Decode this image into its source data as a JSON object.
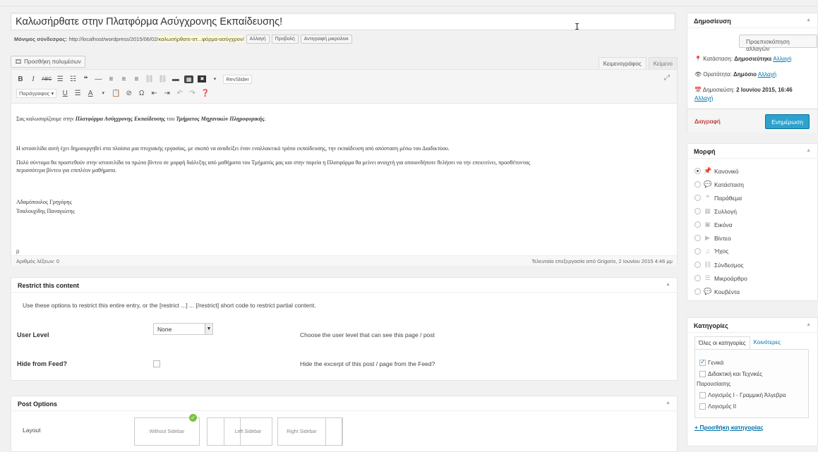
{
  "post": {
    "title": "Καλωσήρθατε στην Πλατφόρμα Ασύγχρονης Εκπαίδευσης!",
    "permalink_label": "Μόνιμος σύνδεσμος:",
    "permalink_url": "http://localhost/wordpress/2015/06/02/",
    "permalink_slug": "καλωσήρθατε-στ...φόρμα-ασύγχρον/",
    "permalink_buttons": [
      "Αλλαγή",
      "Προβολή",
      "Αντιγραφή μικρολινκ"
    ]
  },
  "editor": {
    "add_media": "Προσθήκη πολυμέσων",
    "tab_visual": "Κειμενογράφος",
    "tab_text": "Κείμενο",
    "toolbar_row1": [
      "B",
      "I",
      "ABC",
      "≡",
      "≡",
      "❝",
      "—",
      "≡",
      "≡",
      "≡",
      "🔗",
      "⛓",
      "▬",
      "▦"
    ],
    "revslider": "RevSlider",
    "format_select": "Παράγραφος ▾",
    "toolbar_row2": [
      "U",
      "≡",
      "A ▾",
      "📋",
      "⊘",
      "Ω",
      "⇥",
      "⇤",
      "↶",
      "↷",
      "❓"
    ],
    "content": {
      "p1_pre": "Σας καλωσορίζουμε στην ",
      "p1_bold1": "Πλατφόρμα Ασύγχρονης Εκπαίδευσης",
      "p1_mid": " του ",
      "p1_bold2": "Τμήματος Μηχανικών Πληροφορικής",
      "p1_end": ".",
      "p2": "Η ιστοσελίδα αυτή έχει δημιουργηθεί στα πλαίσια μια πτυχιακής εργασίας, με σκοπό να αναδείξει έναν εναλλακτικό τρόπο εκπαίδευσης, την εκπαίδευση από απόσταση μέσω του Διαδικτύου.",
      "p3": "Πολύ σύντομα θα προστεθούν στην ιστοσελίδα τα πρώτα βίντεο σε μορφή διάλεξης από μαθήματα του Τμήματός μας και στην πορεία η Πλατφόρμα θα μείνει ανοιχτή για οποιονδήποτε θελήσει να την επεκτείνει, προσθέτοντας περισσότερα βίντεο για επιπλέον μαθήματα.",
      "author1": "Αδαμόπουλος Γρηγόρης",
      "author2": "Τσαλουχίδης Παναγιώτης"
    },
    "path": "p",
    "word_count": "Αριθμός λέξεων: 0",
    "last_edit": "Τελευταία επεξεργασία από Grigoris, 2 Ιουνίου 2015 4:46 μμ"
  },
  "restrict": {
    "title": "Restrict this content",
    "description": "Use these options to restrict this entire entry, or the [restrict ...] ... [/restrict] short code to restrict partial content.",
    "user_level_label": "User Level",
    "user_level_value": "None",
    "user_level_desc": "Choose the user level that can see this page / post",
    "hide_feed_label": "Hide from Feed?",
    "hide_feed_desc": "Hide the excerpt of this post / page from the Feed?"
  },
  "post_options": {
    "title": "Post Options",
    "layout_label": "Layout",
    "layouts": [
      "Without Sidebar",
      "Left Sidebar",
      "Right Sidebar"
    ]
  },
  "publish": {
    "title": "Δημοσίευση",
    "preview_btn": "Προεπισκόπηση αλλαγών",
    "status_label": "Κατάσταση:",
    "status_value": "Δημοσιεύτηκε",
    "visibility_label": "Ορατότητα:",
    "visibility_value": "Δημόσιο",
    "published_label": "Δημοσιεύση:",
    "published_value": "2 Ιουνίου 2015, 16:46",
    "edit_link": "Αλλαγή",
    "delete": "Διαγραφή",
    "update": "Ενημέρωση"
  },
  "format": {
    "title": "Μορφή",
    "options": [
      "Κανονικό",
      "Κατάσταση",
      "Παράθεμα",
      "Συλλογή",
      "Εικόνα",
      "Βίντεο",
      "Ήχος",
      "Σύνδεσμος",
      "Μικροάρθρο",
      "Κουβέντα"
    ],
    "selected": "Κανονικό"
  },
  "categories": {
    "title": "Κατηγορίες",
    "tab_all": "Όλες οι κατηγορίες",
    "tab_popular": "Κοινότερες",
    "items": [
      "Γενικά",
      "Διδακτική και Τεχνικές",
      "Παρουσίασης",
      "Λογισμός Ι - Γραμμική Άλγεβρα",
      "Λογισμός ΙΙ"
    ],
    "add_link": "+ Προσθήκη κατηγορίας"
  }
}
